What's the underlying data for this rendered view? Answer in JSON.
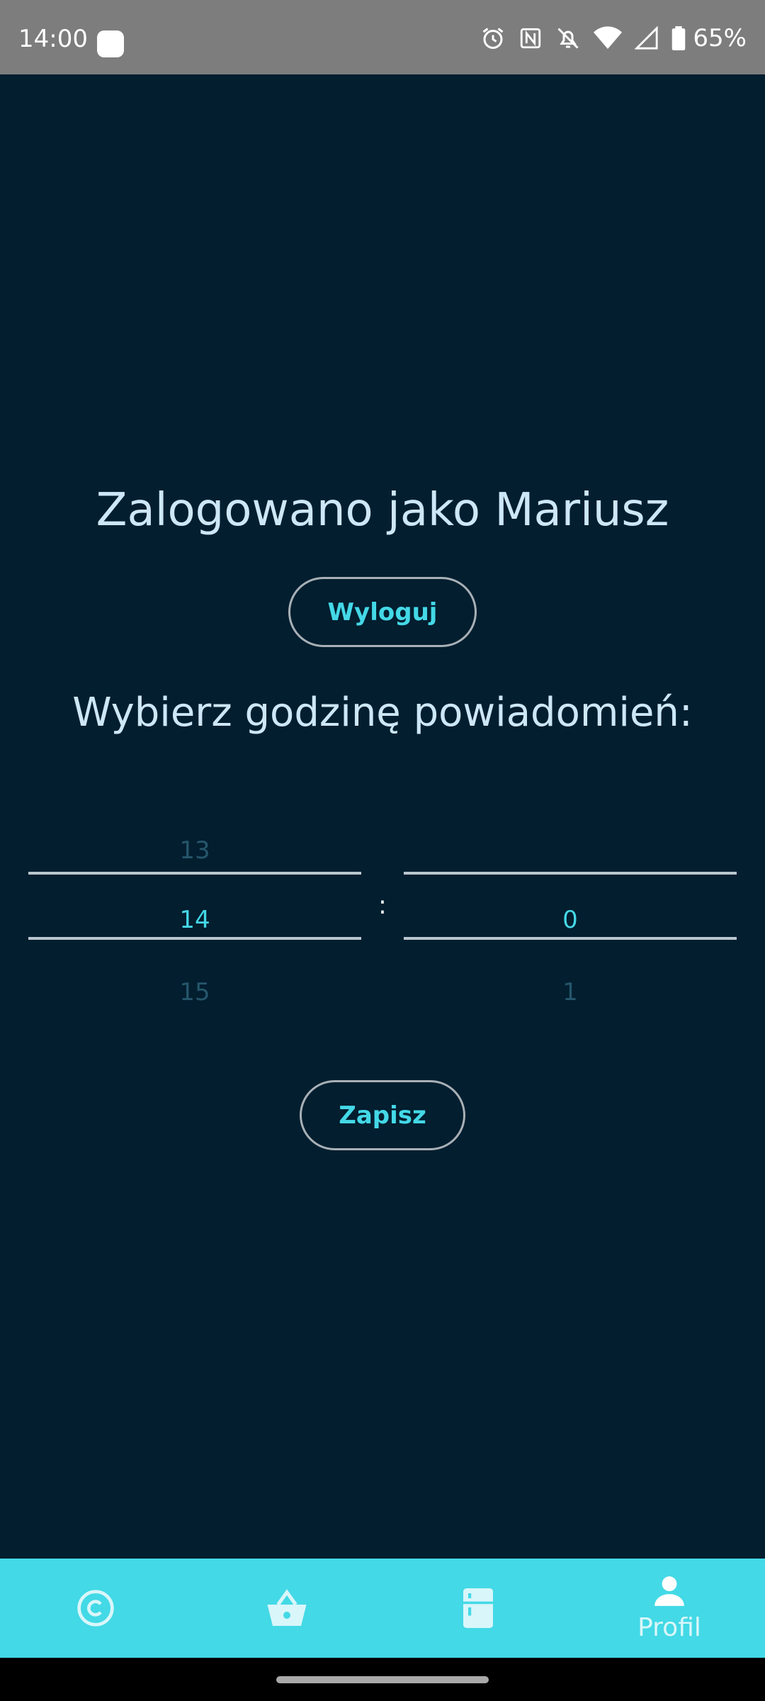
{
  "status_bar": {
    "time": "14:00",
    "battery": "65%",
    "icons": [
      "alarm-icon",
      "nfc-icon",
      "notifications-off-icon",
      "wifi-icon",
      "signal-icon",
      "battery-icon"
    ]
  },
  "main": {
    "title": "Zalogowano jako Mariusz",
    "logout_label": "Wyloguj",
    "subtitle": "Wybierz godzinę powiadomień:",
    "save_label": "Zapisz"
  },
  "time_picker": {
    "hours": {
      "prev": "13",
      "selected": "14",
      "next": "15"
    },
    "separator": ":",
    "minutes": {
      "prev": "",
      "selected": "0",
      "next": "1"
    }
  },
  "bottom_nav": {
    "items": [
      {
        "icon": "copyright-icon",
        "label": ""
      },
      {
        "icon": "basket-icon",
        "label": ""
      },
      {
        "icon": "fridge-icon",
        "label": ""
      },
      {
        "icon": "person-icon",
        "label": "Profil",
        "active": true
      }
    ]
  },
  "colors": {
    "background": "#021E2F",
    "accent": "#44D8E7",
    "nav_background": "#43D9E6",
    "text_primary": "#CDE7F7"
  }
}
